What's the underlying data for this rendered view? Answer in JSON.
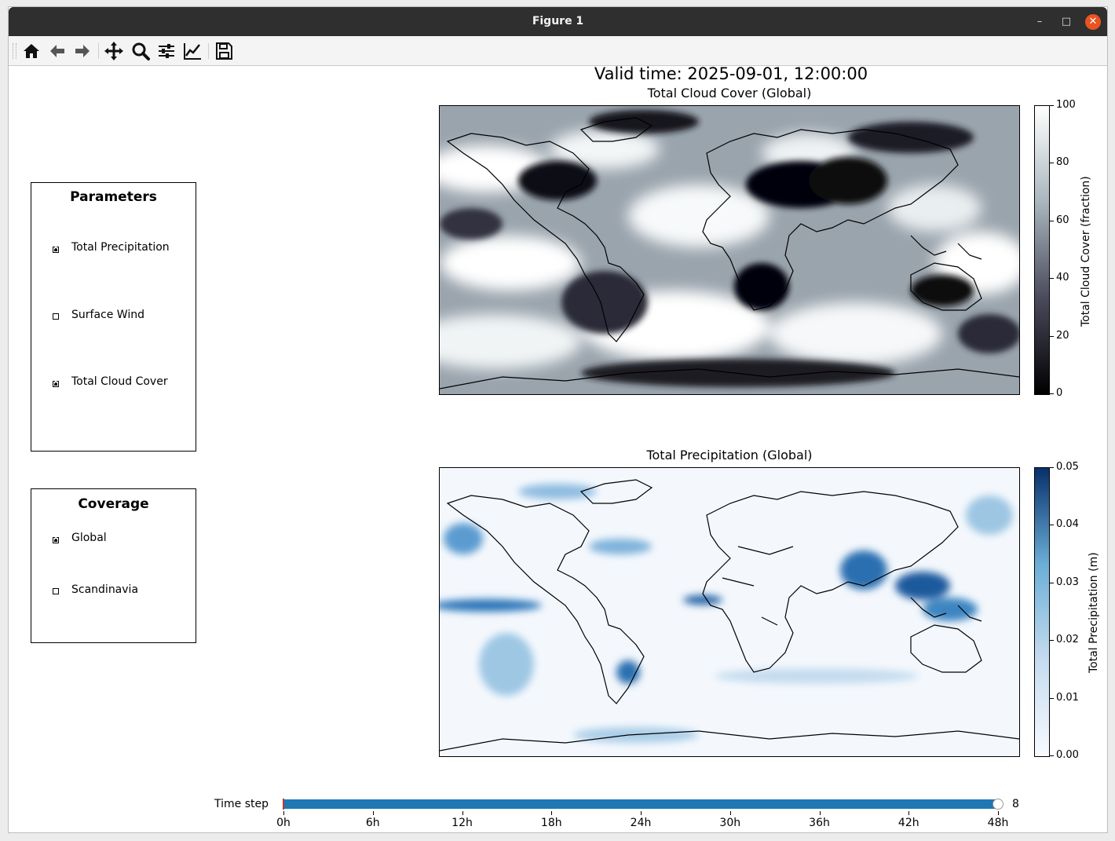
{
  "window": {
    "title": "Figure 1",
    "close_glyph": "✕",
    "minimize_glyph": "–",
    "maximize_glyph": "□"
  },
  "toolbar": {
    "buttons": [
      {
        "name": "home-icon"
      },
      {
        "name": "back-icon"
      },
      {
        "name": "forward-icon"
      },
      {
        "name": "pan-icon"
      },
      {
        "name": "zoom-icon"
      },
      {
        "name": "configure-subplots-icon"
      },
      {
        "name": "edit-axis-icon"
      },
      {
        "name": "save-icon"
      }
    ]
  },
  "figure": {
    "suptitle": "Valid time: 2025-09-01, 12:00:00",
    "cloud": {
      "title": "Total Cloud Cover (Global)",
      "colorbar_label": "Total Cloud Cover (fraction)",
      "ticks": [
        "0",
        "20",
        "40",
        "60",
        "80",
        "100"
      ],
      "colormap": [
        "#000000",
        "#4a4a5c",
        "#a9b6bd",
        "#ffffff"
      ]
    },
    "precip": {
      "title": "Total Precipitation (Global)",
      "colorbar_label": "Total Precipitation (m)",
      "ticks": [
        "0.00",
        "0.01",
        "0.02",
        "0.03",
        "0.04",
        "0.05"
      ],
      "colormap": [
        "#f7fbff",
        "#c6dbef",
        "#6baed6",
        "#08306b"
      ]
    }
  },
  "parameters": {
    "title": "Parameters",
    "items": [
      {
        "label": "Total Precipitation",
        "checked": true
      },
      {
        "label": "Surface Wind",
        "checked": false
      },
      {
        "label": "Total Cloud Cover",
        "checked": true
      }
    ]
  },
  "coverage": {
    "title": "Coverage",
    "items": [
      {
        "label": "Global",
        "checked": true
      },
      {
        "label": "Scandinavia",
        "checked": false
      }
    ]
  },
  "slider": {
    "label": "Time step",
    "value": 8,
    "value_text": "8",
    "min": 0,
    "max": 8,
    "ticks": [
      "0h",
      "6h",
      "12h",
      "18h",
      "24h",
      "30h",
      "36h",
      "42h",
      "48h"
    ],
    "accent": "#1f77b4"
  }
}
